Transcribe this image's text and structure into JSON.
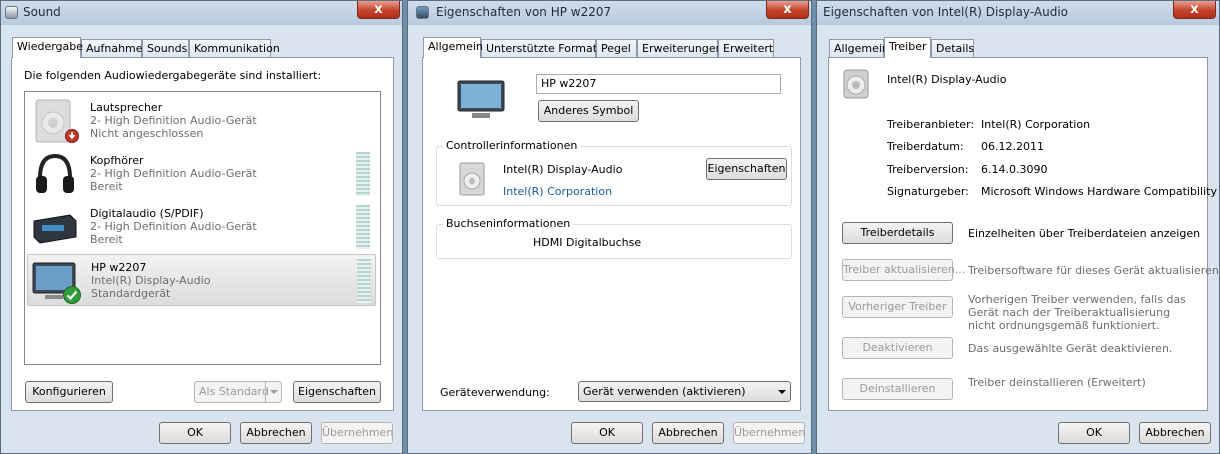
{
  "sound": {
    "title": "Sound",
    "tabs": [
      "Wiedergabe",
      "Aufnahme",
      "Sounds",
      "Kommunikation"
    ],
    "instruction": "Die folgenden Audiowiedergabegeräte sind installiert:",
    "devices": [
      {
        "name": "Lautsprecher",
        "line2": "2- High Definition Audio-Gerät",
        "status": "Nicht angeschlossen",
        "icon": "speaker-icon",
        "badge": "disconnected-badge"
      },
      {
        "name": "Kopfhörer",
        "line2": "2- High Definition Audio-Gerät",
        "status": "Bereit",
        "icon": "headphones-icon"
      },
      {
        "name": "Digitalaudio (S/PDIF)",
        "line2": "2- High Definition Audio-Gerät",
        "status": "Bereit",
        "icon": "digital-audio-icon"
      },
      {
        "name": "HP w2207",
        "line2": "Intel(R) Display-Audio",
        "status": "Standardgerät",
        "icon": "monitor-icon",
        "badge": "default-check-badge"
      }
    ],
    "configure": "Konfigurieren",
    "set_default": "Als Standard",
    "properties": "Eigenschaften",
    "ok": "OK",
    "cancel": "Abbrechen",
    "apply": "Übernehmen",
    "close": "x"
  },
  "hp": {
    "title": "Eigenschaften von HP w2207",
    "tabs": [
      "Allgemein",
      "Unterstützte Formate",
      "Pegel",
      "Erweiterungen",
      "Erweitert"
    ],
    "device_name": "HP w2207",
    "change_icon": "Anderes Symbol",
    "controller_title": "Controllerinformationen",
    "controller_name": "Intel(R) Display-Audio",
    "controller_vendor": "Intel(R) Corporation",
    "controller_props": "Eigenschaften",
    "jack_title": "Buchseninformationen",
    "jack_value": "HDMI Digitalbuchse",
    "usage_label": "Geräteverwendung:",
    "usage_value": "Gerät verwenden (aktivieren)",
    "ok": "OK",
    "cancel": "Abbrechen",
    "apply": "Übernehmen",
    "close": "x"
  },
  "intel": {
    "title": "Eigenschaften von Intel(R) Display-Audio",
    "tabs": [
      "Allgemein",
      "Treiber",
      "Details"
    ],
    "device_name": "Intel(R) Display-Audio",
    "fields": [
      {
        "label": "Treiberanbieter:",
        "value": "Intel(R) Corporation"
      },
      {
        "label": "Treiberdatum:",
        "value": "06.12.2011"
      },
      {
        "label": "Treiberversion:",
        "value": "6.14.0.3090"
      },
      {
        "label": "Signaturgeber:",
        "value": "Microsoft Windows Hardware Compatibility"
      }
    ],
    "actions": [
      {
        "button": "Treiberdetails",
        "desc": "Einzelheiten über Treiberdateien anzeigen",
        "enabled": true
      },
      {
        "button": "Treiber aktualisieren...",
        "desc": "Treibersoftware für dieses Gerät aktualisieren",
        "enabled": false
      },
      {
        "button": "Vorheriger Treiber",
        "desc": "Vorherigen Treiber verwenden, falls das Gerät nach der Treiberaktualisierung nicht ordnungsgemäß funktioniert.",
        "enabled": false
      },
      {
        "button": "Deaktivieren",
        "desc": "Das ausgewählte Gerät deaktivieren.",
        "enabled": false
      },
      {
        "button": "Deinstallieren",
        "desc": "Treiber deinstallieren (Erweitert)",
        "enabled": false
      }
    ],
    "ok": "OK",
    "cancel": "Abbrechen",
    "close": "x"
  }
}
